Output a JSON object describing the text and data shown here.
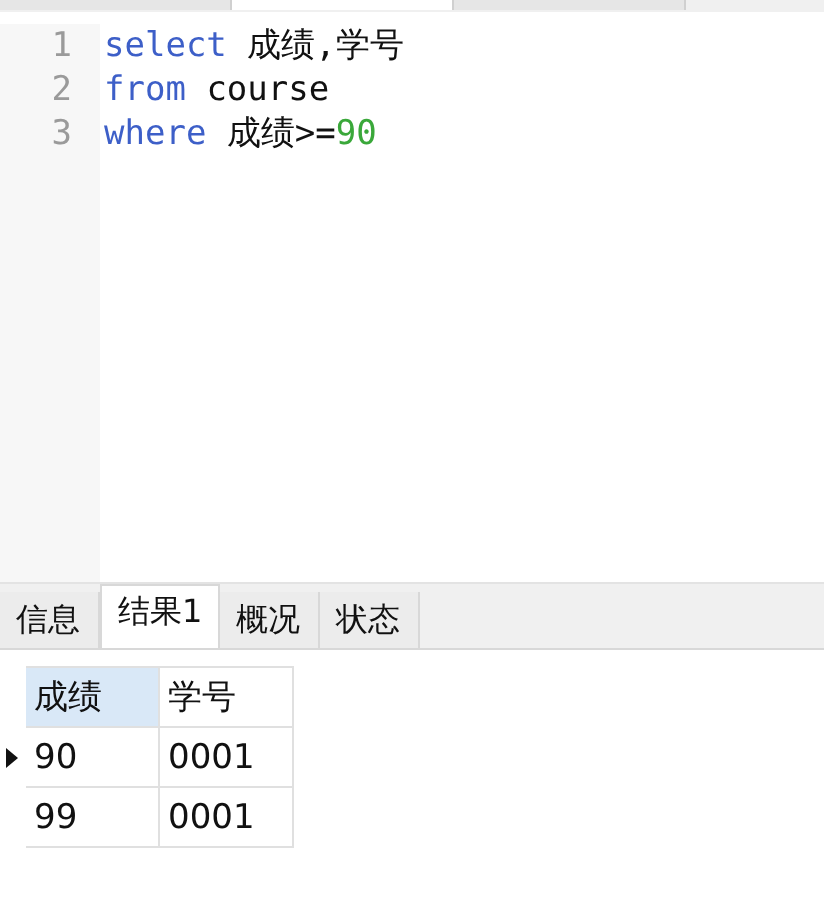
{
  "editor_tabs": [
    {
      "selected": false
    },
    {
      "selected": true
    },
    {
      "selected": false
    }
  ],
  "editor": {
    "lines": [
      {
        "number": "1",
        "tokens": [
          {
            "kind": "keyword",
            "text": "select"
          },
          {
            "kind": "plain",
            "text": " 成绩,学号"
          }
        ]
      },
      {
        "number": "2",
        "tokens": [
          {
            "kind": "keyword",
            "text": "from"
          },
          {
            "kind": "plain",
            "text": " course"
          }
        ]
      },
      {
        "number": "3",
        "tokens": [
          {
            "kind": "keyword",
            "text": "where"
          },
          {
            "kind": "plain",
            "text": " 成绩>="
          },
          {
            "kind": "number",
            "text": "90"
          }
        ]
      }
    ]
  },
  "result_tabs": [
    {
      "label": "信息",
      "selected": false
    },
    {
      "label": "结果1",
      "selected": true
    },
    {
      "label": "概况",
      "selected": false
    },
    {
      "label": "状态",
      "selected": false
    }
  ],
  "grid": {
    "columns": [
      {
        "label": "成绩",
        "selected": true
      },
      {
        "label": "学号",
        "selected": false
      }
    ],
    "rows": [
      {
        "current": true,
        "cells": [
          "90",
          "0001"
        ]
      },
      {
        "current": false,
        "cells": [
          "99",
          "0001"
        ]
      }
    ]
  }
}
